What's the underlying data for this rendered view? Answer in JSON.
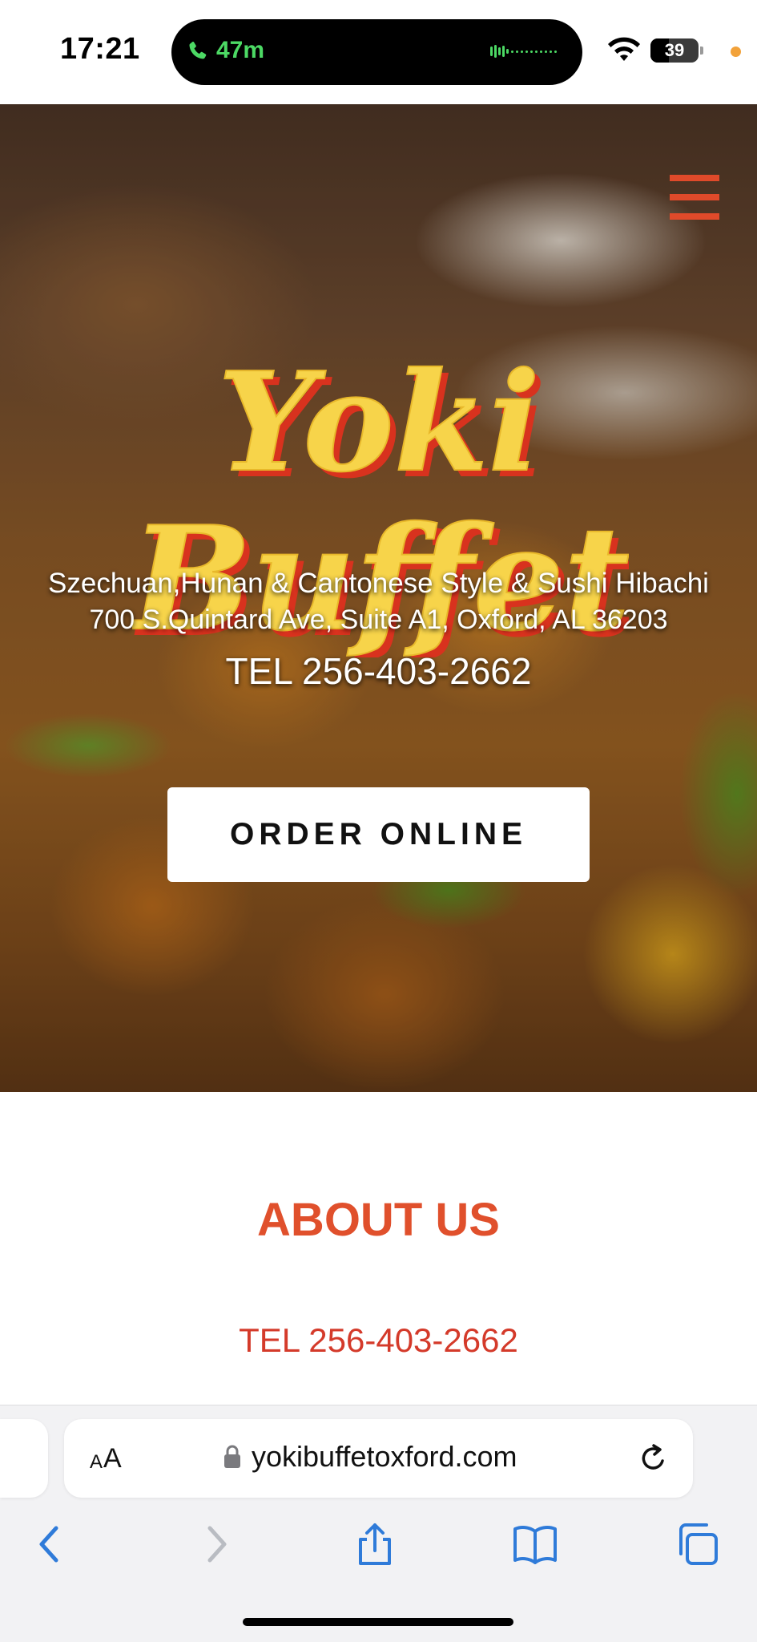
{
  "status_bar": {
    "time": "17:21",
    "call_duration": "47m",
    "battery_level": "39",
    "battery_fraction": 0.39,
    "call_color": "#4cd964"
  },
  "hero": {
    "logo_line1": "Yoki",
    "logo_line2": "Buffet",
    "tagline": "Szechuan,Hunan & Cantonese Style & Sushi Hibachi",
    "address": "700 S.Quintard Ave, Suite A1, Oxford, AL 36203",
    "tel": "TEL 256-403-2662",
    "order_button": "ORDER ONLINE",
    "logo_color": "#f7d44a",
    "logo_shadow_color": "#d8321e",
    "menu_icon_color": "#e04a2a"
  },
  "about": {
    "title": "ABOUT US",
    "tel": "TEL 256-403-2662",
    "title_color": "#e0502c",
    "tel_color": "#d43a2a"
  },
  "browser": {
    "text_size_small": "A",
    "text_size_large": "A",
    "url": "yokibuffetoxford.com",
    "accent_color": "#2f7bd9",
    "icons": [
      "lock-icon",
      "reload-icon",
      "back-arrow-icon",
      "forward-arrow-icon",
      "share-icon",
      "bookmarks-icon",
      "tabs-icon"
    ]
  }
}
